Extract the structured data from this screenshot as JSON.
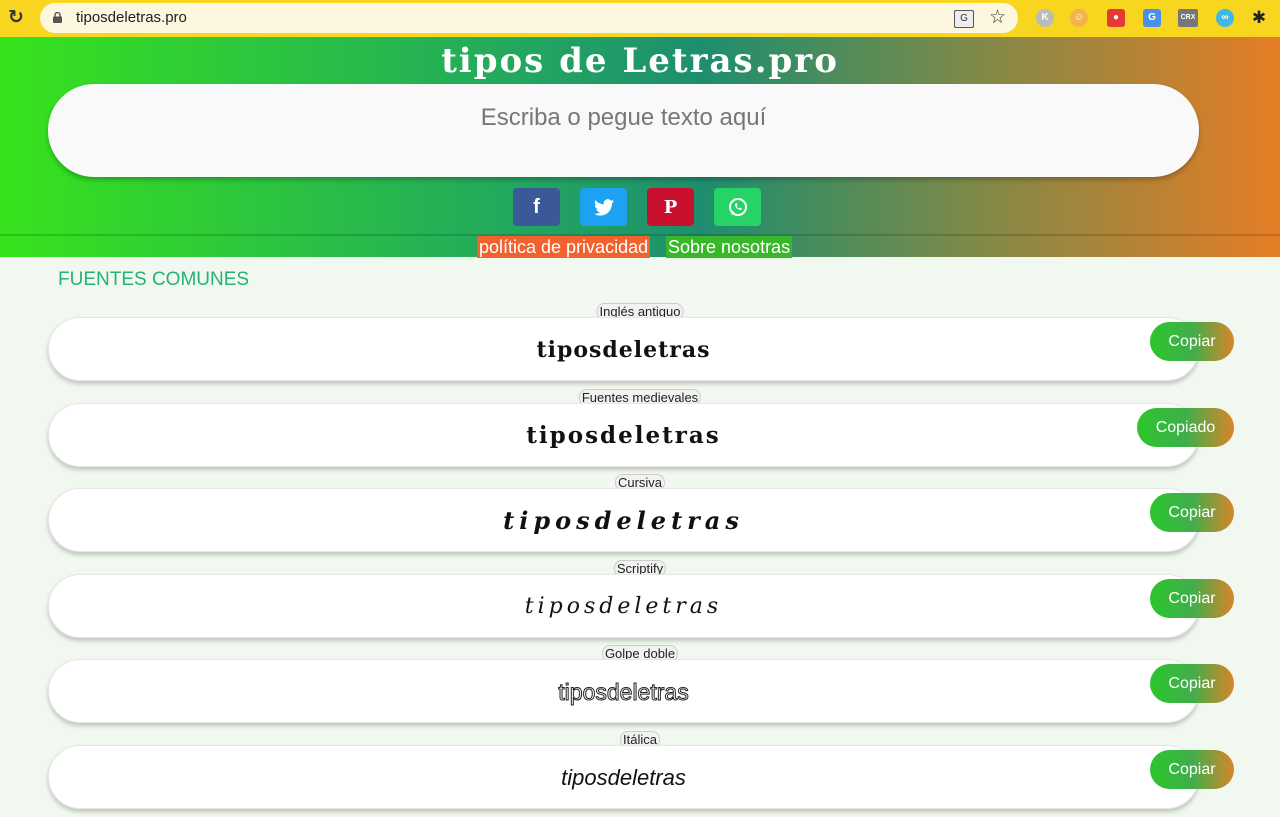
{
  "browser": {
    "url": "tiposdeletras.pro",
    "reload_icon": "reload-icon",
    "extensions": [
      "K",
      "CRX"
    ]
  },
  "header": {
    "title": "tipos de Letras.pro",
    "input_placeholder": "Escriba o pegue texto aquí",
    "share": {
      "facebook": "f",
      "twitter": "twitter-bird-icon",
      "pinterest": "P",
      "whatsapp": "whatsapp-icon"
    },
    "links": {
      "privacy": "política de privacidad",
      "about": "Sobre nosotras"
    }
  },
  "colors": {
    "facebook": "#3b5998",
    "twitter": "#1da1f2",
    "pinterest": "#c8102e",
    "whatsapp": "#25d366",
    "section_title": "#27b07a"
  },
  "section_title": "FUENTES COMUNES",
  "fonts": [
    {
      "label": "Inglés antiguo",
      "text": "tiposdeletras",
      "button": "Copiar"
    },
    {
      "label": "Fuentes medievales",
      "text": "tiposdeletras",
      "button": "Copiado"
    },
    {
      "label": "Cursiva",
      "text": "tiposdeletras",
      "button": "Copiar"
    },
    {
      "label": "Scriptify",
      "text": "tiposdeletras",
      "button": "Copiar"
    },
    {
      "label": "Golpe doble",
      "text": "tiposdeletras",
      "button": "Copiar"
    },
    {
      "label": "Itálica",
      "text": "tiposdeletras",
      "button": "Copiar"
    }
  ]
}
